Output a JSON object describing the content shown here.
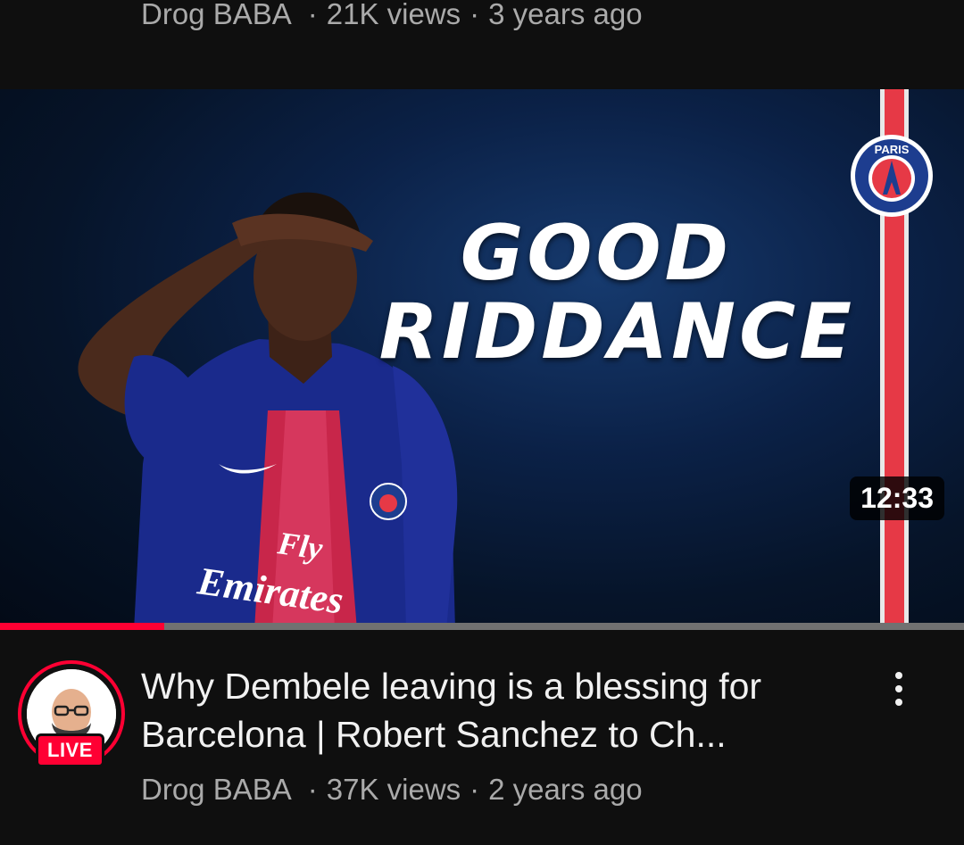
{
  "previous_video": {
    "channel": "Drog BABA",
    "views": "21K views",
    "age": "3 years ago"
  },
  "video": {
    "thumbnail": {
      "headline_line1": "GOOD",
      "headline_line2": "RIDDANCE",
      "sponsor_line1": "Fly",
      "sponsor_line2": "Emirates",
      "crest_text": "PARIS"
    },
    "duration": "12:33",
    "watched_progress": 0.17,
    "title": "Why Dembele leaving is a blessing for Barcelona | Robert Sanchez to Ch...",
    "channel": "Drog BABA",
    "views": "37K views",
    "age": "2 years ago",
    "live_badge": "LIVE",
    "more_icon": "more-vertical-icon"
  },
  "colors": {
    "background": "#0f0f0f",
    "accent": "#ff0033",
    "secondary_text": "#aaaaaa"
  }
}
